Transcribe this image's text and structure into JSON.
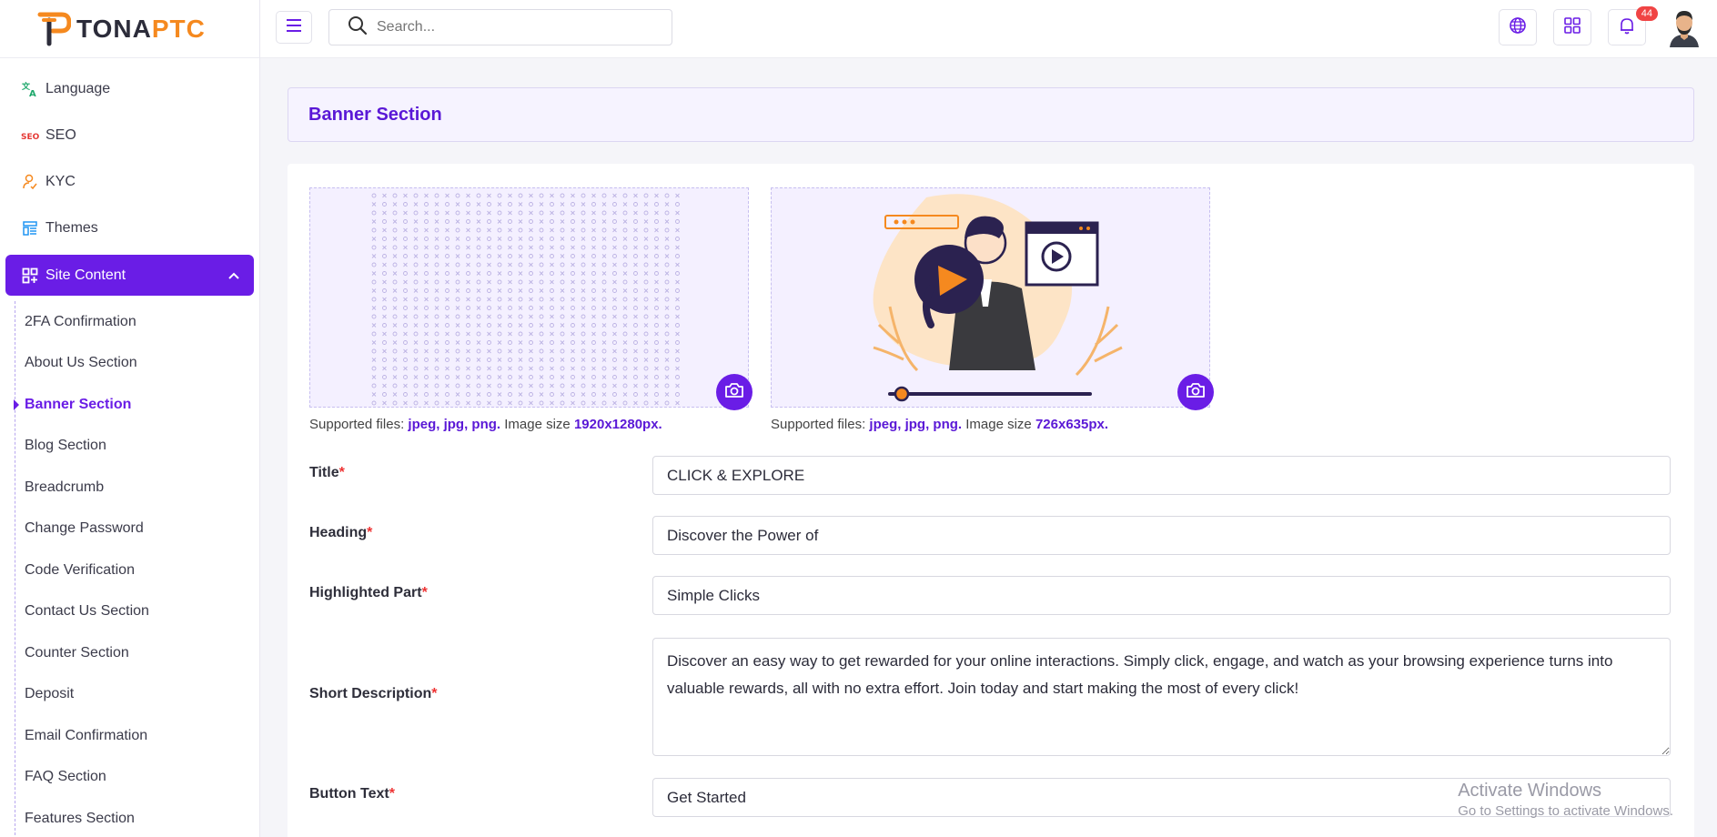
{
  "brand": {
    "part1": "TONA",
    "part2": "PTC"
  },
  "sidebar": {
    "items": [
      {
        "label": "Language",
        "icon": "translate-icon"
      },
      {
        "label": "SEO",
        "icon": "seo-icon"
      },
      {
        "label": "KYC",
        "icon": "user-check-icon"
      },
      {
        "label": "Themes",
        "icon": "layout-icon"
      }
    ],
    "active_group": {
      "label": "Site Content",
      "icon": "grid-plus-icon"
    },
    "sub_items": [
      "2FA Confirmation",
      "About Us Section",
      "Banner Section",
      "Blog Section",
      "Breadcrumb",
      "Change Password",
      "Code Verification",
      "Contact Us Section",
      "Counter Section",
      "Deposit",
      "Email Confirmation",
      "FAQ Section",
      "Features Section"
    ],
    "active_sub": "Banner Section"
  },
  "topbar": {
    "search_placeholder": "Search...",
    "notification_count": "44"
  },
  "page": {
    "title": "Banner Section"
  },
  "images": [
    {
      "note_prefix": "Supported files:",
      "formats": "jpeg, jpg, png.",
      "size_label": "Image size",
      "size": "1920x1280px."
    },
    {
      "note_prefix": "Supported files:",
      "formats": "jpeg, jpg, png.",
      "size_label": "Image size",
      "size": "726x635px."
    }
  ],
  "form": {
    "title": {
      "label": "Title",
      "value": "CLICK & EXPLORE"
    },
    "heading": {
      "label": "Heading",
      "value": "Discover the Power of"
    },
    "highlighted": {
      "label": "Highlighted Part",
      "value": "Simple Clicks"
    },
    "short_description": {
      "label": "Short Description",
      "value": "Discover an easy way to get rewarded for your online interactions. Simply click, engage, and watch as your browsing experience turns into valuable rewards, all with no extra effort. Join today and start making the most of every click!"
    },
    "button_text": {
      "label": "Button Text",
      "value": "Get Started"
    }
  },
  "watermark": {
    "line1": "Activate Windows",
    "line2": "Go to Settings to activate Windows."
  },
  "colors": {
    "accent": "#6a1de6",
    "brand_orange": "#f5891f",
    "required": "#e33333"
  }
}
